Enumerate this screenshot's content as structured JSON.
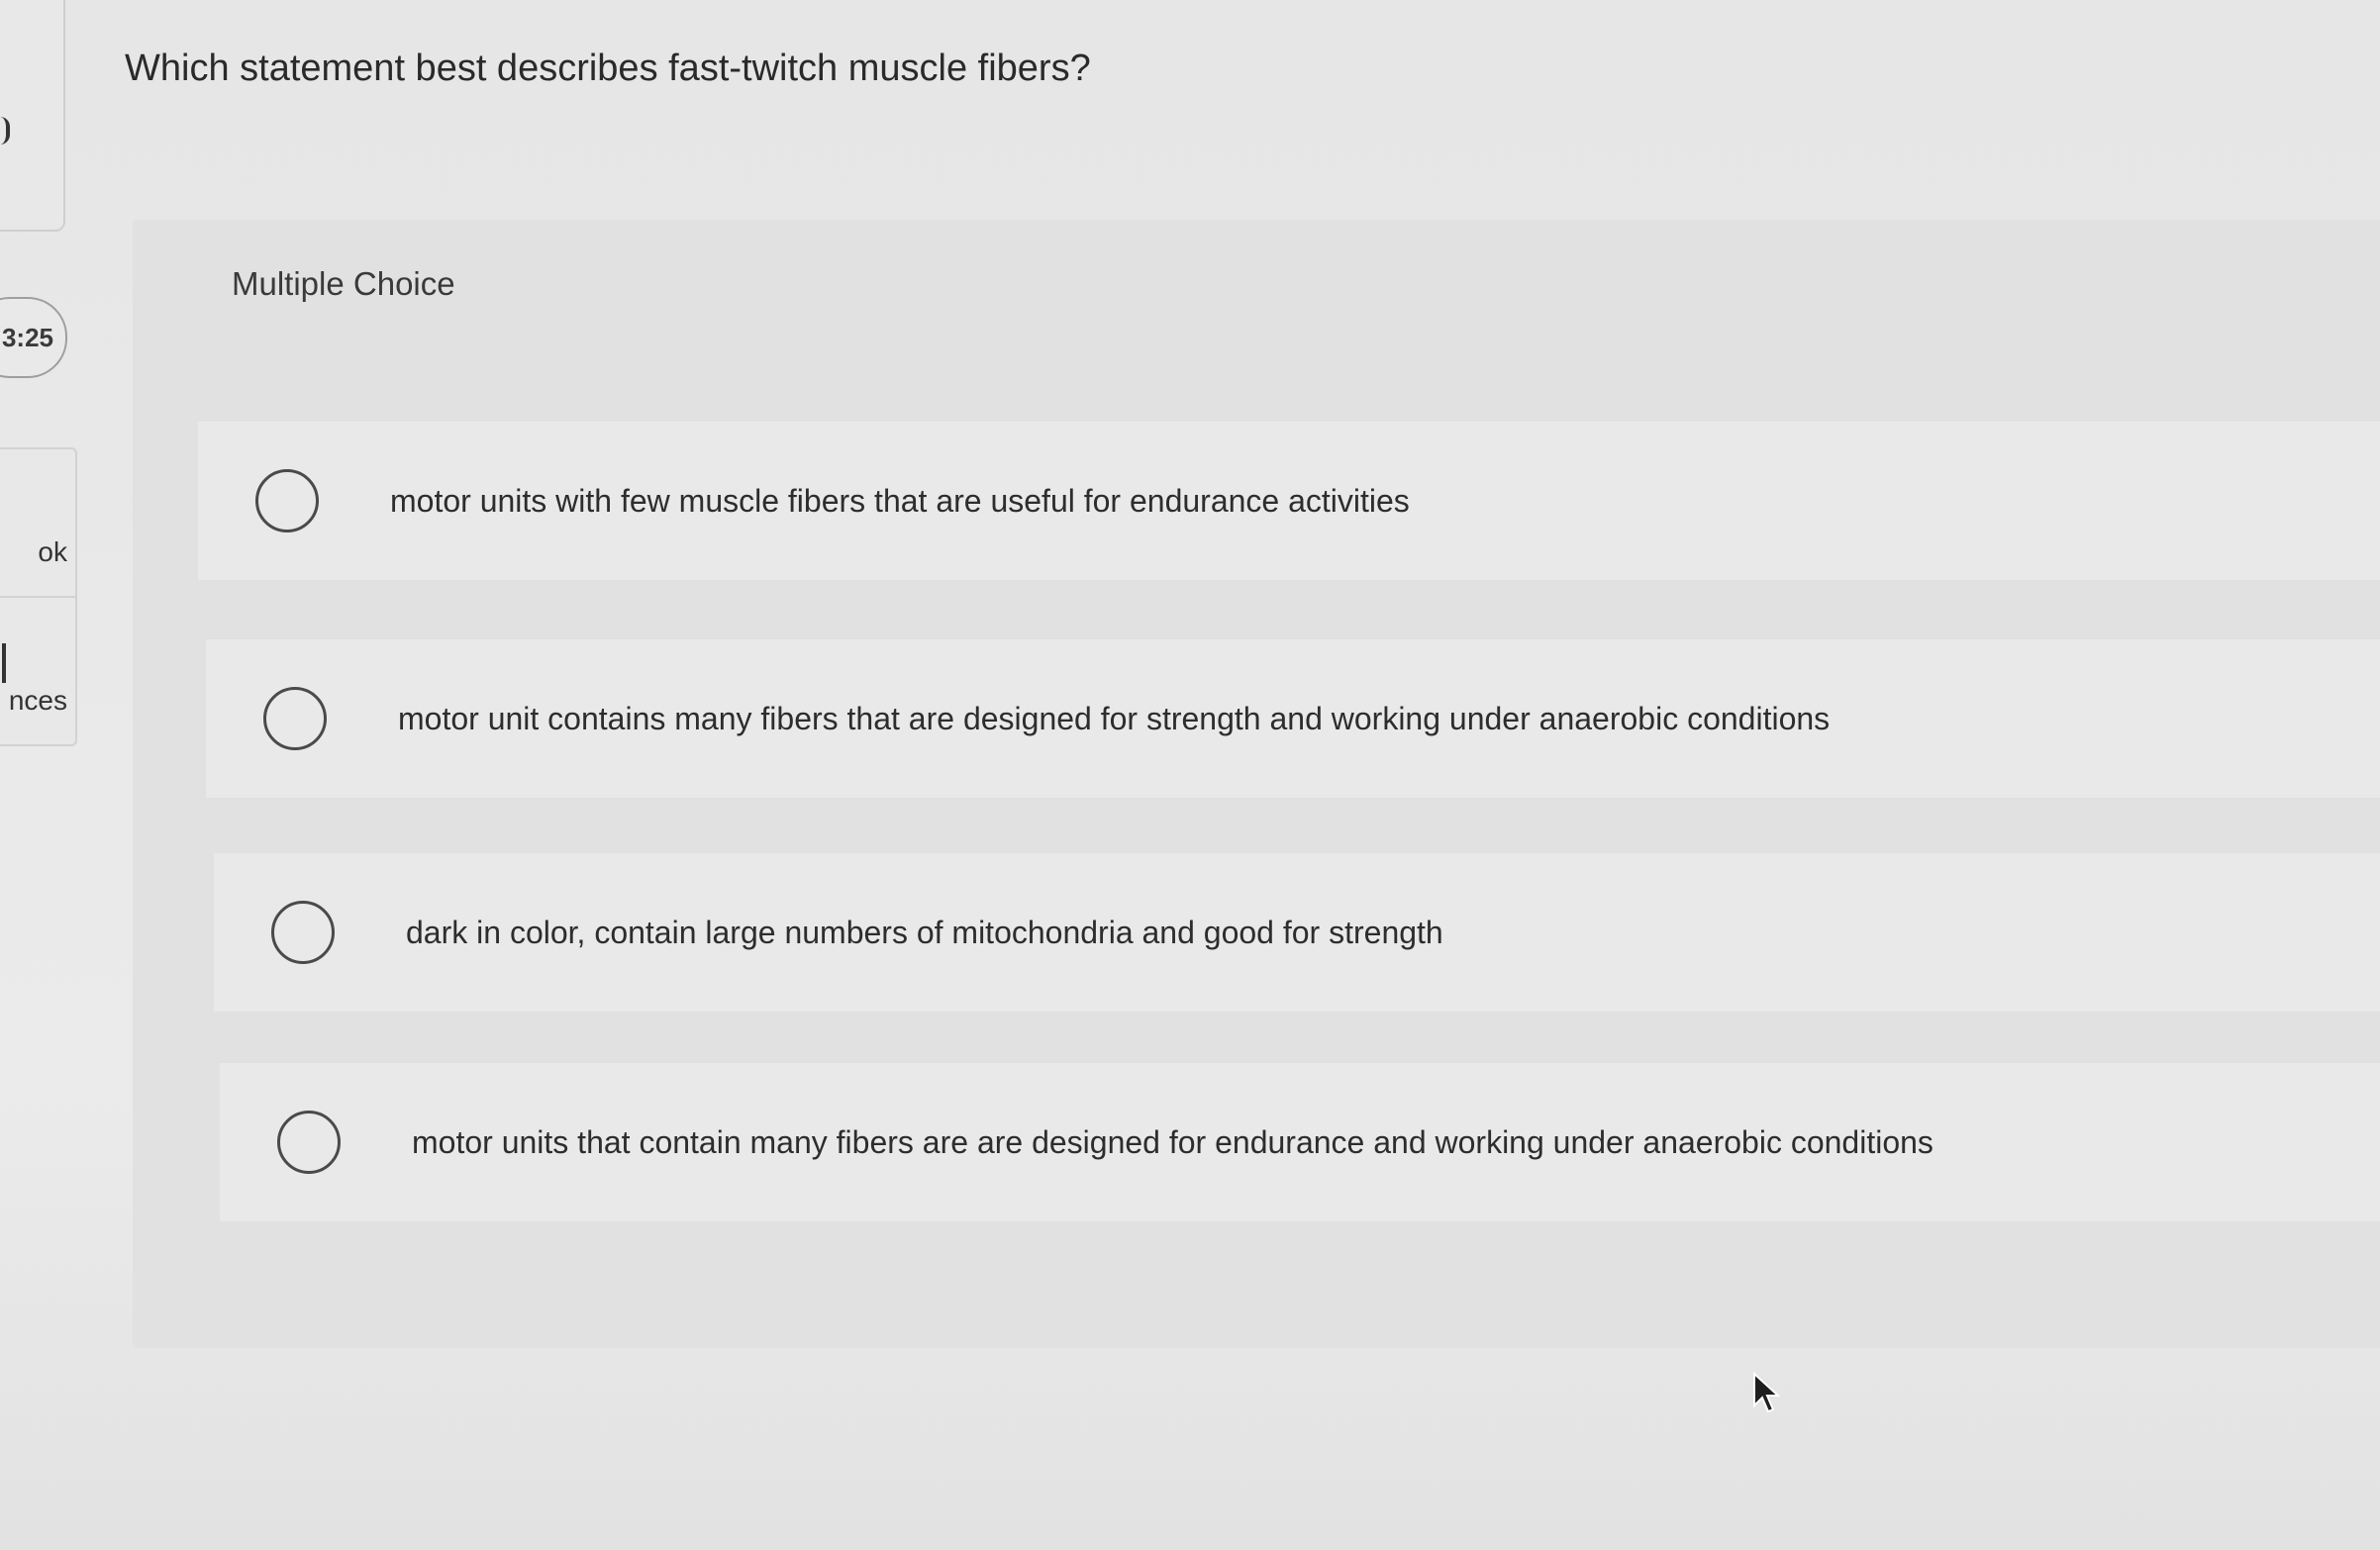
{
  "question": {
    "text": "Which statement best describes fast-twitch muscle fibers?"
  },
  "sidebar": {
    "timer": "3:25",
    "item_1_label": "ok",
    "item_2_label": "nces"
  },
  "answer_panel": {
    "type_label": "Multiple Choice",
    "choices": [
      {
        "label": "motor units with few muscle fibers that are useful for endurance activities",
        "selected": false
      },
      {
        "label": "motor unit contains many fibers that are designed for strength and working under anaerobic conditions",
        "selected": false
      },
      {
        "label": "dark in color, contain large numbers of mitochondria and good for strength",
        "selected": false
      },
      {
        "label": "motor units that contain many fibers are are designed for endurance and working under anaerobic conditions",
        "selected": false
      }
    ]
  }
}
